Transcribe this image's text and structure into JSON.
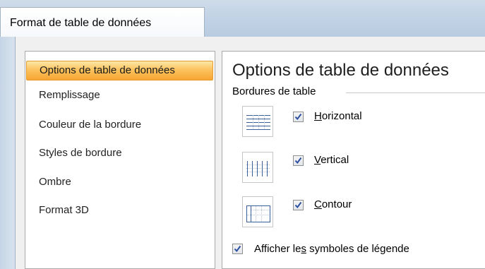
{
  "window": {
    "title": "Format de table de données"
  },
  "nav": {
    "items": [
      {
        "label": "Options de table de données",
        "selected": true
      },
      {
        "label": "Remplissage",
        "selected": false
      },
      {
        "label": "Couleur de la bordure",
        "selected": false
      },
      {
        "label": "Styles de bordure",
        "selected": false
      },
      {
        "label": "Ombre",
        "selected": false
      },
      {
        "label": "Format 3D",
        "selected": false
      }
    ]
  },
  "panel": {
    "title": "Options de table de données",
    "section_label": "Bordures de table",
    "options": [
      {
        "label_pre": "",
        "label_key": "H",
        "label_post": "orizontal",
        "checked": true,
        "icon": "horizontal-borders-icon"
      },
      {
        "label_pre": "",
        "label_key": "V",
        "label_post": "ertical",
        "checked": true,
        "icon": "vertical-borders-icon"
      },
      {
        "label_pre": "",
        "label_key": "C",
        "label_post": "ontour",
        "checked": true,
        "icon": "outline-border-icon"
      }
    ],
    "legend_option": {
      "label_pre": "Afficher le",
      "label_key": "s",
      "label_post": " symboles de légende",
      "checked": true
    }
  },
  "colors": {
    "accent_selected": "#fbc35f",
    "checkbox_check": "#2b4fa0",
    "table_icon_line": "#3a5f9a"
  }
}
